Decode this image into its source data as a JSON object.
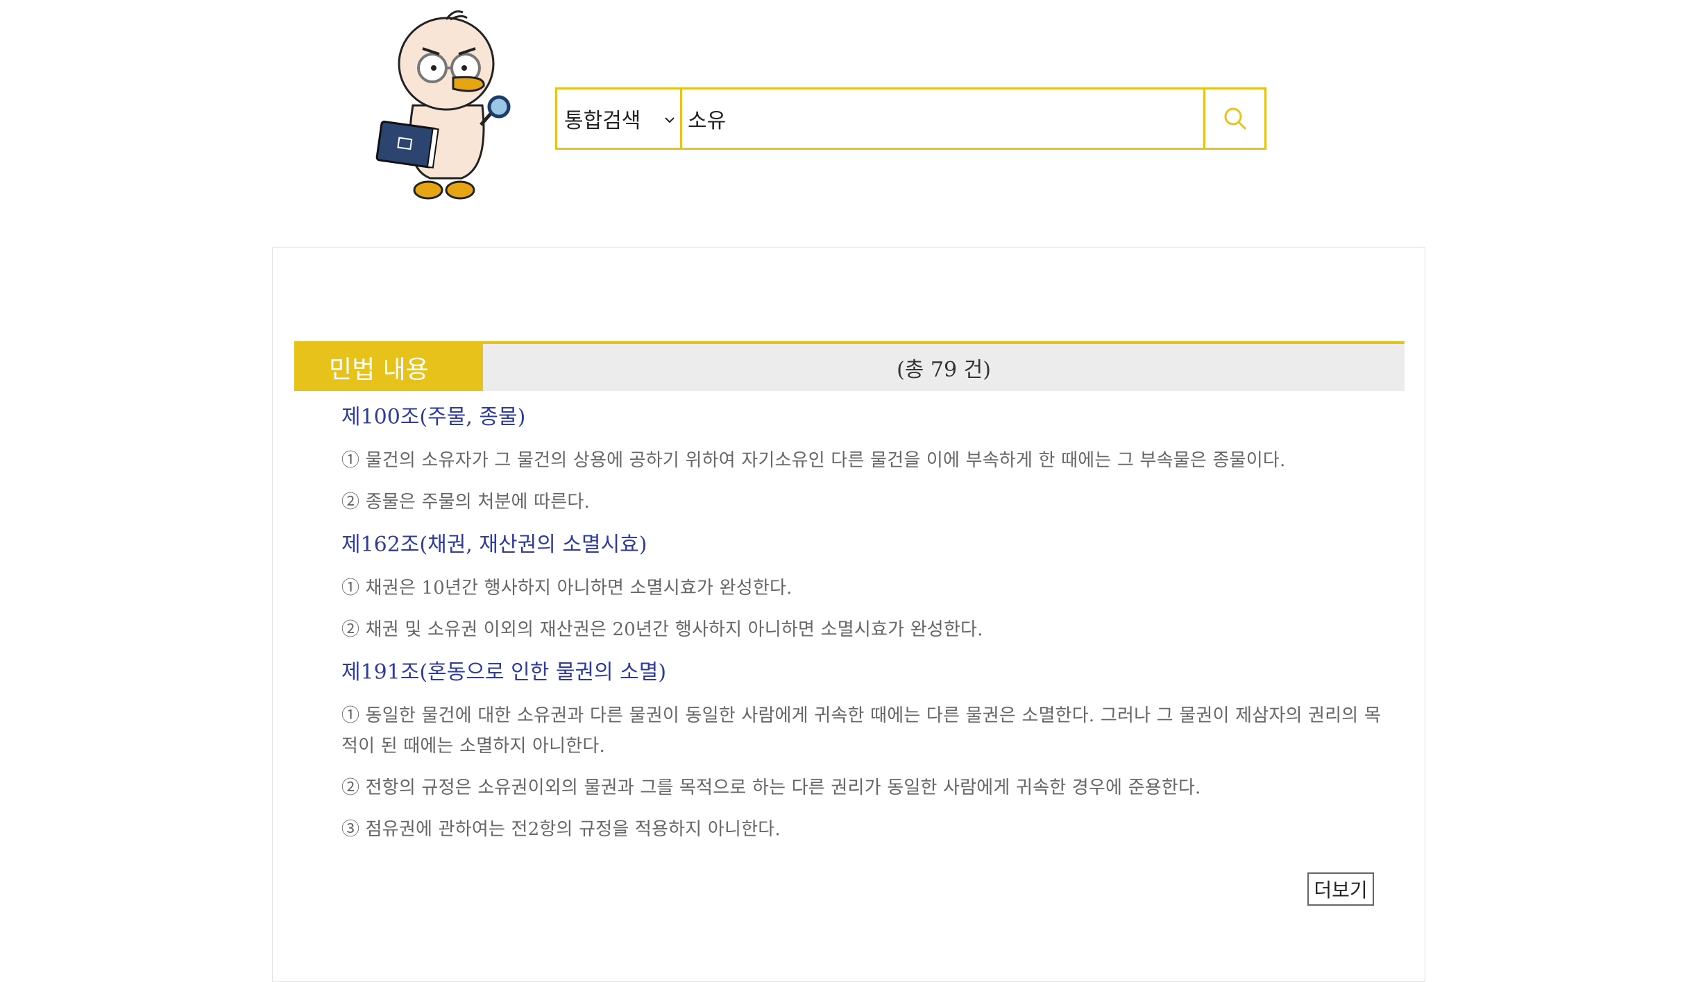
{
  "mascot": {
    "icon": "duck-lawyer-mascot-icon"
  },
  "search": {
    "scope_selected": "통합검색",
    "query": "소유",
    "button_icon": "search-icon",
    "accent_color": "#e6c21b"
  },
  "section": {
    "tab_label": "민법 내용",
    "count_text": "(총 79 건)"
  },
  "articles": [
    {
      "title": "제100조(주물, 종물)",
      "clauses": [
        "① 물건의 소유자가 그 물건의 상용에 공하기 위하여 자기소유인 다른 물건을 이에 부속하게 한 때에는 그 부속물은 종물이다.",
        "② 종물은 주물의 처분에 따른다."
      ]
    },
    {
      "title": "제162조(채권, 재산권의 소멸시효)",
      "clauses": [
        "① 채권은 10년간 행사하지 아니하면 소멸시효가 완성한다.",
        "② 채권 및 소유권 이외의 재산권은 20년간 행사하지 아니하면 소멸시효가 완성한다."
      ]
    },
    {
      "title": "제191조(혼동으로 인한 물권의 소멸)",
      "clauses": [
        "① 동일한 물건에 대한 소유권과 다른 물권이 동일한 사람에게 귀속한 때에는 다른 물권은 소멸한다. 그러나 그 물권이 제삼자의 권리의 목적이 된 때에는 소멸하지 아니한다.",
        "② 전항의 규정은 소유권이외의 물권과 그를 목적으로 하는 다른 권리가 동일한 사람에게 귀속한 경우에 준용한다.",
        "③ 점유권에 관하여는 전2항의 규정을 적용하지 아니한다."
      ]
    }
  ],
  "more_label": "더보기"
}
